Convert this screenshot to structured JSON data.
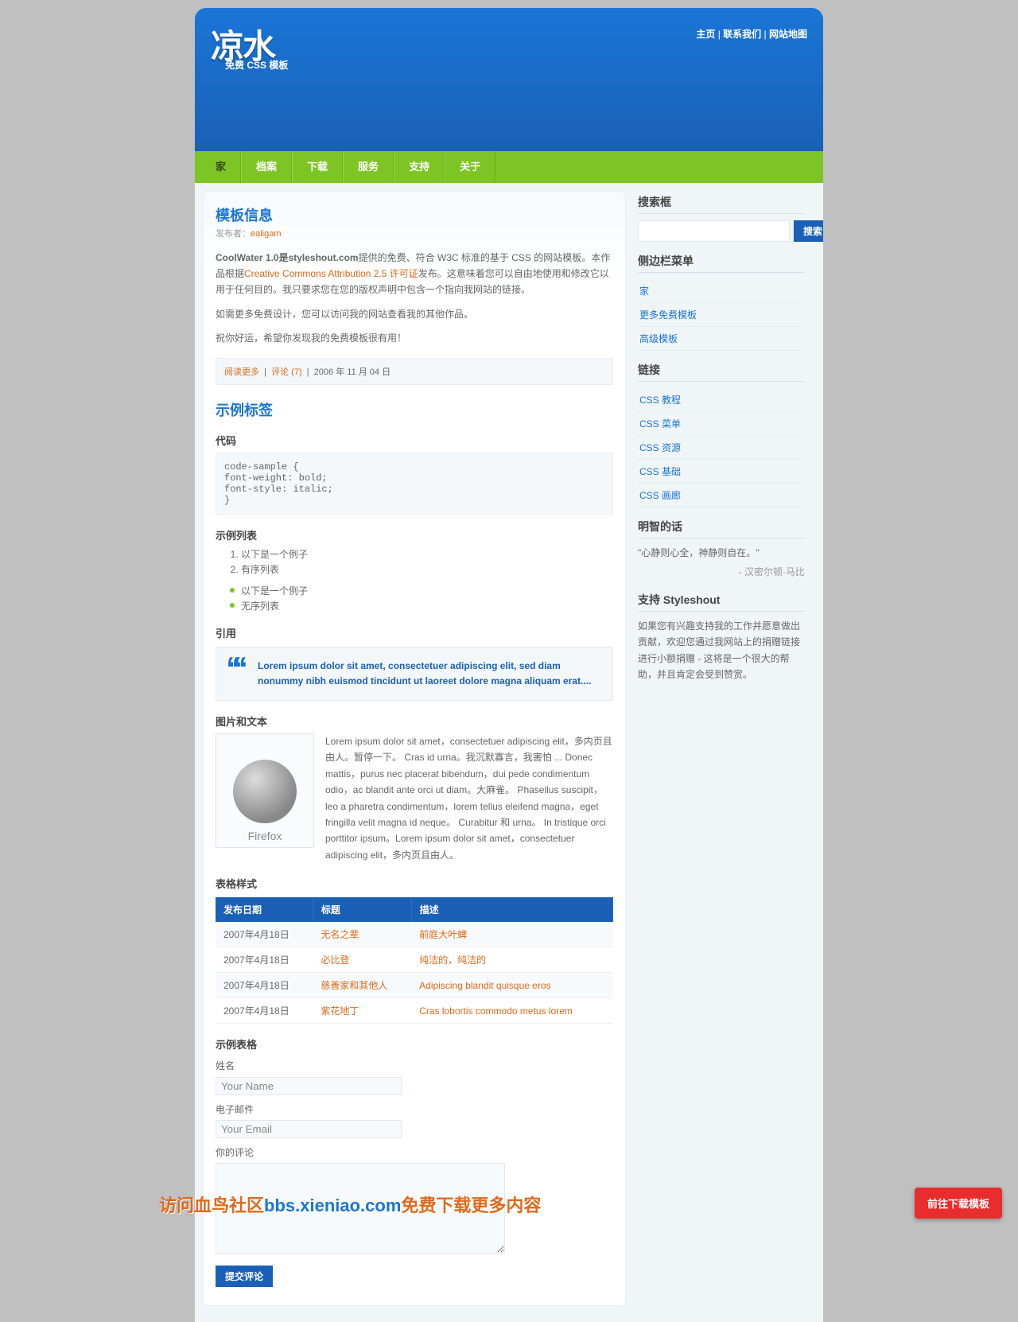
{
  "header": {
    "title": "凉水",
    "subtitle": "免费 CSS 模板",
    "topnav": [
      "主页",
      "联系我们",
      "网站地图"
    ]
  },
  "menu": {
    "items": [
      "家",
      "档案",
      "下载",
      "服务",
      "支持",
      "关于"
    ]
  },
  "post": {
    "title": "模板信息",
    "byline_prefix": "发布者：",
    "byline_author": "ealigam",
    "p1_strong": "CoolWater 1.0是styleshout.com",
    "p1_rest": "提供的免费、符合 W3C 标准的基于 CSS 的网站模板。本作品根据",
    "p1_link": "Creative Commons Attribution 2.5 许可证",
    "p1_tail": "发布。这意味着您可以自由地使用和修改它以用于任何目的。我只要求您在您的版权声明中包含一个指向我网站的链接。",
    "p2": "如需更多免费设计，您可以访问我的网站查看我的其他作品。",
    "p3": "祝你好运，希望你发现我的免费模板很有用！",
    "meta_readmore": "阅读更多",
    "meta_comments": "评论 (7)",
    "meta_date": "2006 年 11 月 04 日"
  },
  "tags": {
    "title": "示例标签",
    "code_h": "代码",
    "code": "code-sample {\nfont-weight: bold;\nfont-style: italic;\n}",
    "list_h": "示例列表",
    "ol": [
      "以下是一个例子",
      "有序列表"
    ],
    "ul": [
      "以下是一个例子",
      "无序列表"
    ],
    "quote_h": "引用",
    "quote": "Lorem ipsum dolor sit amet, consectetuer adipiscing elit, sed diam nonummy nibh euismod tincidunt ut laoreet dolore magna aliquam erat....",
    "img_h": "图片和文本",
    "img_label": "Firefox",
    "img_text": "Lorem ipsum dolor sit amet，consectetuer adipiscing elit，多内页且由人。暂停一下。 Cras id urna。我沉默寡言，我害怕 ... Donec mattis，purus nec placerat bibendum，dui pede condimentum odio，ac blandit ante orci ut diam。大麻雀。 Phasellus suscipit，leo a pharetra condimentum，lorem tellus eleifend magna，eget fringilla velit magna id neque。 Curabitur 和 urna。 In tristique orci porttitor ipsum。Lorem ipsum dolor sit amet，consectetuer adipiscing elit，多内页且由人。"
  },
  "table": {
    "title": "表格样式",
    "headers": [
      "发布日期",
      "标题",
      "描述"
    ],
    "rows": [
      [
        "2007年4月18日",
        "无名之辈",
        "前庭大叶蜱"
      ],
      [
        "2007年4月18日",
        "必比登",
        "纯洁的，纯洁的"
      ],
      [
        "2007年4月18日",
        "慈善家和其他人",
        "Adipiscing blandit quisque eros"
      ],
      [
        "2007年4月18日",
        "紫花地丁",
        "Cras lobortis commodo metus lorem"
      ]
    ]
  },
  "form": {
    "title": "示例表格",
    "name_l": "姓名",
    "name_ph": "Your Name",
    "email_l": "电子邮件",
    "email_ph": "Your Email",
    "msg_l": "你的评论",
    "submit": "提交评论"
  },
  "sidebar": {
    "search_h": "搜索框",
    "search_btn": "搜索",
    "menu_h": "侧边栏菜单",
    "menu_items": [
      "家",
      "更多免费模板",
      "高级模板"
    ],
    "links_h": "链接",
    "links_items": [
      "CSS 教程",
      "CSS 菜单",
      "CSS 资源",
      "CSS 基础",
      "CSS 画廊"
    ],
    "wise_h": "明智的话",
    "wise_quote": "\"心静则心全，神静则自在。\"",
    "wise_author": "- 汉密尔顿·马比",
    "support_h": "支持 Styleshout",
    "support_text": "如果您有兴趣支持我的工作并愿意做出贡献，欢迎您通过我网站上的捐赠链接进行小额捐赠 - 这将是一个很大的帮助，并且肯定会受到赞赏。"
  },
  "floating_btn": "前往下载模板",
  "overlay": {
    "a": "访问血鸟社区",
    "b": "bbs.xieniao.com",
    "c": "免费下载更多内容"
  }
}
